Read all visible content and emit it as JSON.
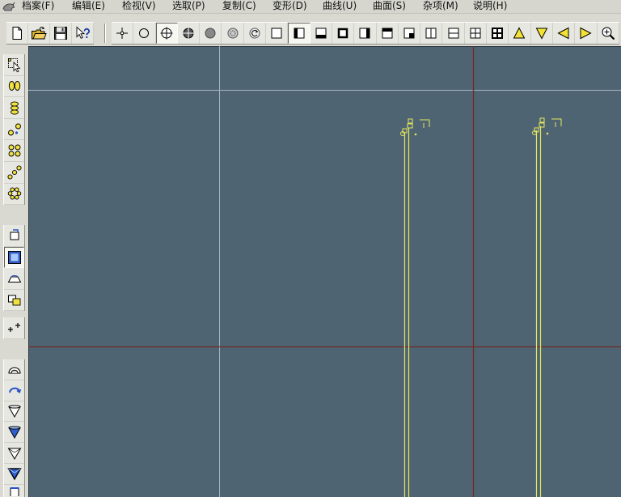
{
  "menu": {
    "items": [
      "档案(F)",
      "编辑(E)",
      "检视(V)",
      "选取(P)",
      "复制(C)",
      "变形(D)",
      "曲线(U)",
      "曲面(S)",
      "杂项(M)",
      "说明(H)"
    ]
  },
  "toolbar": {
    "groups": [
      [
        {
          "icon": "new-document-icon"
        },
        {
          "icon": "open-folder-icon"
        },
        {
          "icon": "save-icon"
        },
        {
          "icon": "context-help-icon"
        }
      ],
      [
        {
          "icon": "point-icon"
        },
        {
          "icon": "circle-icon"
        },
        {
          "icon": "circle-crosshair-icon",
          "pressed": true
        },
        {
          "icon": "filled-circle-crosshair-icon"
        },
        {
          "icon": "solid-circle-icon"
        },
        {
          "icon": "circle-target-icon"
        },
        {
          "icon": "rotate-circle-icon"
        },
        {
          "icon": "square-icon"
        },
        {
          "icon": "square-left-icon",
          "pressed": true
        },
        {
          "icon": "square-bottom-icon"
        },
        {
          "icon": "square-thick-icon"
        },
        {
          "icon": "square-right-icon"
        },
        {
          "icon": "square-top-icon"
        },
        {
          "icon": "square-bottom-right-icon"
        },
        {
          "icon": "split-vertical-icon"
        },
        {
          "icon": "split-horizontal-icon"
        },
        {
          "icon": "grid-four-icon"
        },
        {
          "icon": "grid-four-bold-icon"
        },
        {
          "icon": "triangle-up-icon"
        },
        {
          "icon": "triangle-down-icon"
        },
        {
          "icon": "triangle-left-icon"
        },
        {
          "icon": "triangle-right-icon"
        },
        {
          "icon": "zoom-icon"
        }
      ]
    ]
  },
  "left_toolbar": {
    "groups": [
      [
        {
          "icon": "select-icon"
        },
        {
          "icon": "two-ellipses-icon"
        },
        {
          "icon": "ellipse-stack-icon"
        },
        {
          "icon": "ellipse-dots-icon"
        },
        {
          "icon": "four-ellipses-icon"
        },
        {
          "icon": "diagonal-ellipses-icon"
        },
        {
          "icon": "ellipse-ring-icon"
        }
      ],
      [
        {
          "icon": "rectangle-mark-icon"
        },
        {
          "icon": "blue-square-icon",
          "pressed": true
        },
        {
          "icon": "dome-icon"
        },
        {
          "icon": "overlap-rect-icon"
        }
      ],
      [
        {
          "icon": "points-icon"
        }
      ],
      [
        {
          "icon": "arch-icon"
        },
        {
          "icon": "curved-arrow-icon"
        },
        {
          "icon": "cone-outline-icon"
        },
        {
          "icon": "cone-blue-icon"
        },
        {
          "icon": "pyramid-outline-icon"
        },
        {
          "icon": "pyramid-blue-icon"
        },
        {
          "icon": "cylinder-icon"
        }
      ]
    ]
  },
  "colors": {
    "menu-bg": "#d6d6cf",
    "toolbar-bg": "#d9d9d2",
    "button-bg": "#e7e7e1",
    "pressed-bg": "#f7f7f2",
    "viewport-bg": "#4f6473",
    "grid-line": "#a9b4bb",
    "axis-line": "#6f2b24",
    "curve": "#e4e65c"
  }
}
